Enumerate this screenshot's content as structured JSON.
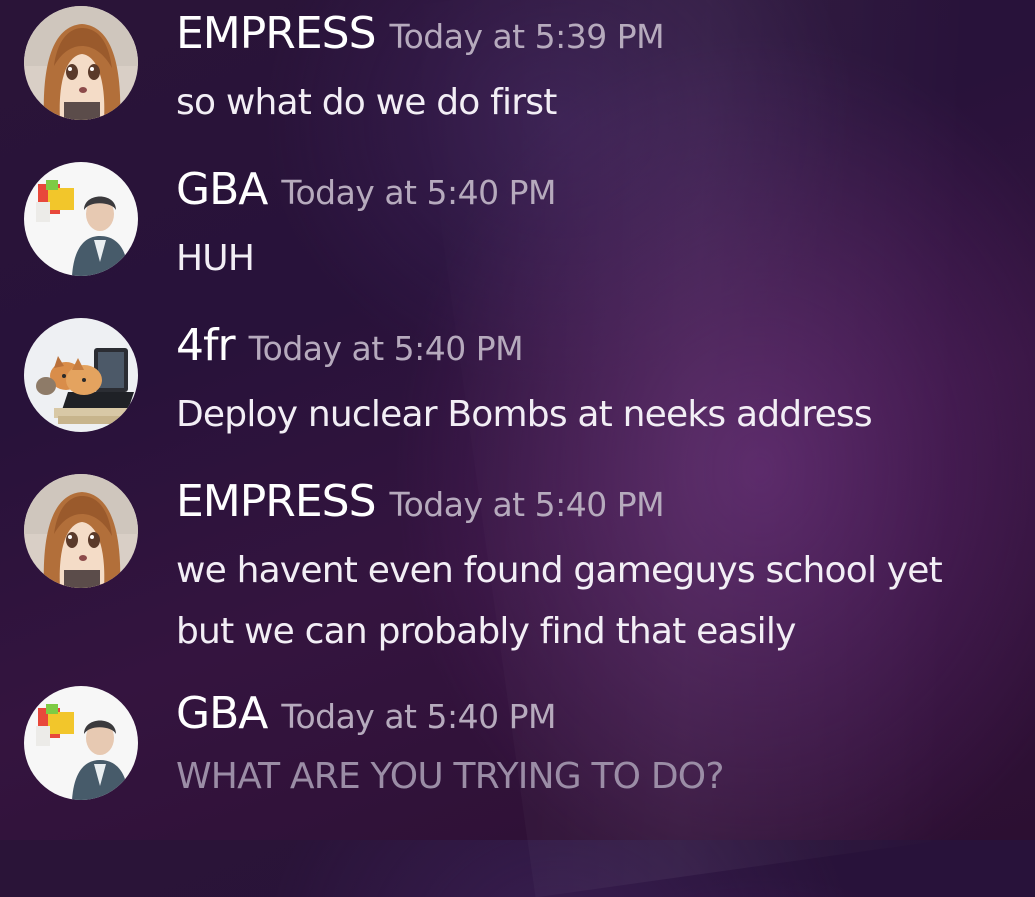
{
  "messages": [
    {
      "author": "EMPRESS",
      "timestamp": "Today at 5:39 PM",
      "lines": [
        "so what do we do first"
      ],
      "avatar_icon": "anime-girl-avatar"
    },
    {
      "author": "GBA",
      "timestamp": "Today at 5:40 PM",
      "lines": [
        "HUH"
      ],
      "avatar_icon": "person-with-blocks-avatar"
    },
    {
      "author": "4fr",
      "timestamp": "Today at 5:40 PM",
      "lines": [
        "Deploy nuclear Bombs at neeks address"
      ],
      "avatar_icon": "cats-on-laptop-avatar"
    },
    {
      "author": "EMPRESS",
      "timestamp": "Today at 5:40 PM",
      "lines": [
        "we havent even found gameguys school yet",
        "but we can probably find that easily"
      ],
      "avatar_icon": "anime-girl-avatar"
    },
    {
      "author": "GBA",
      "timestamp": "Today at 5:40 PM",
      "lines": [
        "WHAT ARE YOU TRYING TO DO?"
      ],
      "avatar_icon": "person-with-blocks-avatar",
      "state": "sending"
    }
  ],
  "colors": {
    "username": "#ffffff",
    "timestamp": "#b6aabd",
    "message_text": "#f2eef5",
    "pending_text": "#9b8da6",
    "background": "#2a1438"
  }
}
